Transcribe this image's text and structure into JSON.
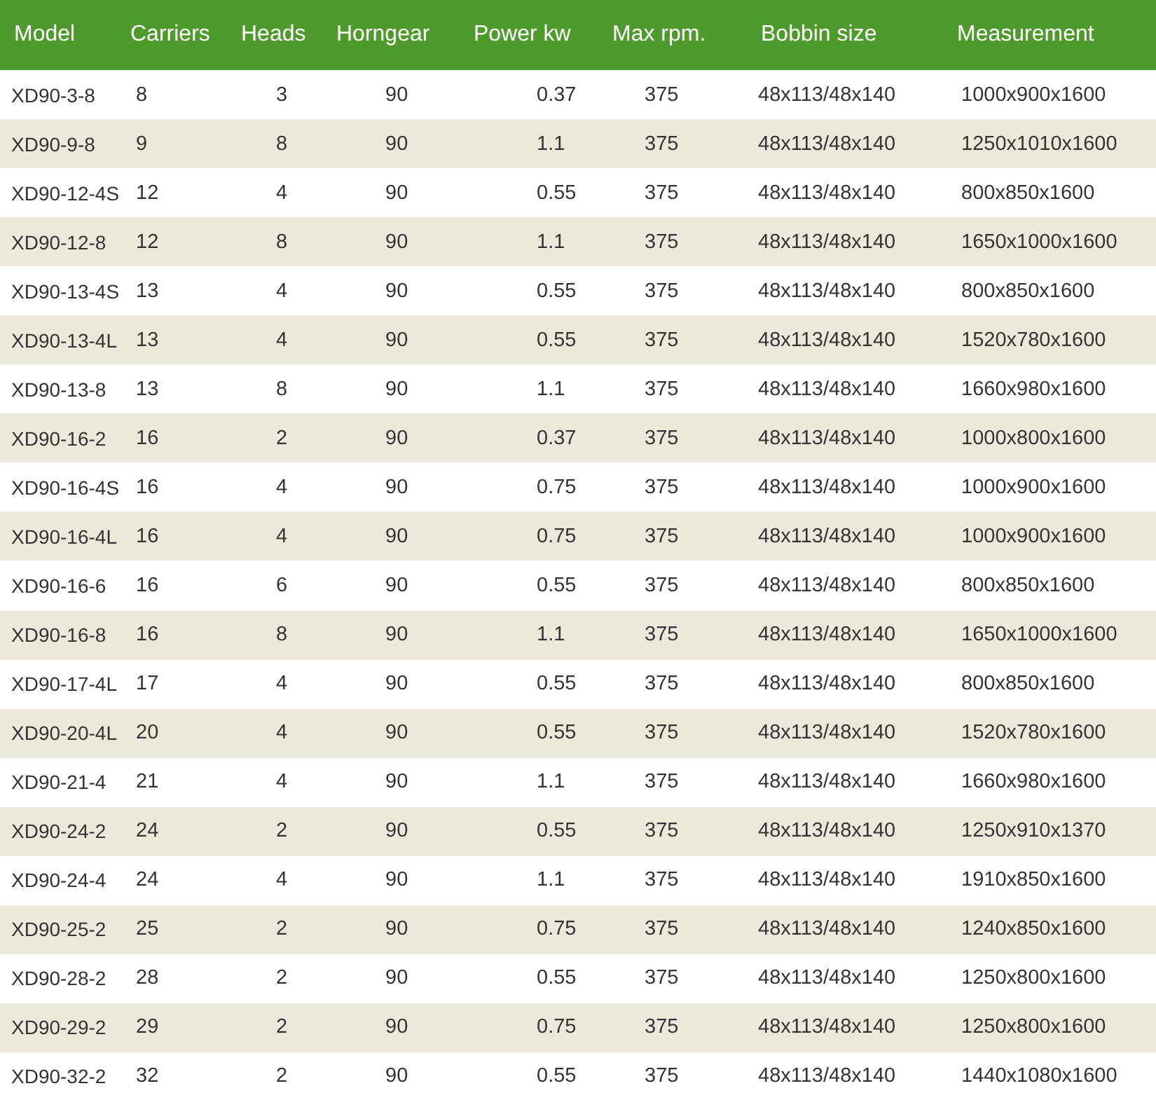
{
  "table": {
    "columns": [
      "Model",
      "Carriers",
      "Heads",
      "Horngear",
      "Power kw",
      "Max rpm.",
      "Bobbin size",
      "Measurement"
    ],
    "rows": [
      [
        "XD90-3-8",
        "8",
        "3",
        "90",
        "0.37",
        "375",
        "48x113/48x140",
        "1000x900x1600"
      ],
      [
        "XD90-9-8",
        "9",
        "8",
        "90",
        "1.1",
        "375",
        "48x113/48x140",
        "1250x1010x1600"
      ],
      [
        "XD90-12-4S",
        "12",
        "4",
        "90",
        "0.55",
        "375",
        "48x113/48x140",
        "800x850x1600"
      ],
      [
        "XD90-12-8",
        "12",
        "8",
        "90",
        "1.1",
        "375",
        "48x113/48x140",
        "1650x1000x1600"
      ],
      [
        "XD90-13-4S",
        "13",
        "4",
        "90",
        "0.55",
        "375",
        "48x113/48x140",
        "800x850x1600"
      ],
      [
        "XD90-13-4L",
        "13",
        "4",
        "90",
        "0.55",
        "375",
        "48x113/48x140",
        "1520x780x1600"
      ],
      [
        "XD90-13-8",
        "13",
        "8",
        "90",
        "1.1",
        "375",
        "48x113/48x140",
        "1660x980x1600"
      ],
      [
        "XD90-16-2",
        "16",
        "2",
        "90",
        "0.37",
        "375",
        "48x113/48x140",
        "1000x800x1600"
      ],
      [
        "XD90-16-4S",
        "16",
        "4",
        "90",
        "0.75",
        "375",
        "48x113/48x140",
        "1000x900x1600"
      ],
      [
        "XD90-16-4L",
        "16",
        "4",
        "90",
        "0.75",
        "375",
        "48x113/48x140",
        "1000x900x1600"
      ],
      [
        "XD90-16-6",
        "16",
        "6",
        "90",
        "0.55",
        "375",
        "48x113/48x140",
        "800x850x1600"
      ],
      [
        "XD90-16-8",
        "16",
        "8",
        "90",
        "1.1",
        "375",
        "48x113/48x140",
        "1650x1000x1600"
      ],
      [
        "XD90-17-4L",
        "17",
        "4",
        "90",
        "0.55",
        "375",
        "48x113/48x140",
        "800x850x1600"
      ],
      [
        "XD90-20-4L",
        "20",
        "4",
        "90",
        "0.55",
        "375",
        "48x113/48x140",
        "1520x780x1600"
      ],
      [
        "XD90-21-4",
        "21",
        "4",
        "90",
        "1.1",
        "375",
        "48x113/48x140",
        "1660x980x1600"
      ],
      [
        "XD90-24-2",
        "24",
        "2",
        "90",
        "0.55",
        "375",
        "48x113/48x140",
        "1250x910x1370"
      ],
      [
        "XD90-24-4",
        "24",
        "4",
        "90",
        "1.1",
        "375",
        "48x113/48x140",
        "1910x850x1600"
      ],
      [
        "XD90-25-2",
        "25",
        "2",
        "90",
        "0.75",
        "375",
        "48x113/48x140",
        "1240x850x1600"
      ],
      [
        "XD90-28-2",
        "28",
        "2",
        "90",
        "0.55",
        "375",
        "48x113/48x140",
        "1250x800x1600"
      ],
      [
        "XD90-29-2",
        "29",
        "2",
        "90",
        "0.75",
        "375",
        "48x113/48x140",
        "1250x800x1600"
      ],
      [
        "XD90-32-2",
        "32",
        "2",
        "90",
        "0.55",
        "375",
        "48x113/48x140",
        "1440x1080x1600"
      ]
    ]
  }
}
